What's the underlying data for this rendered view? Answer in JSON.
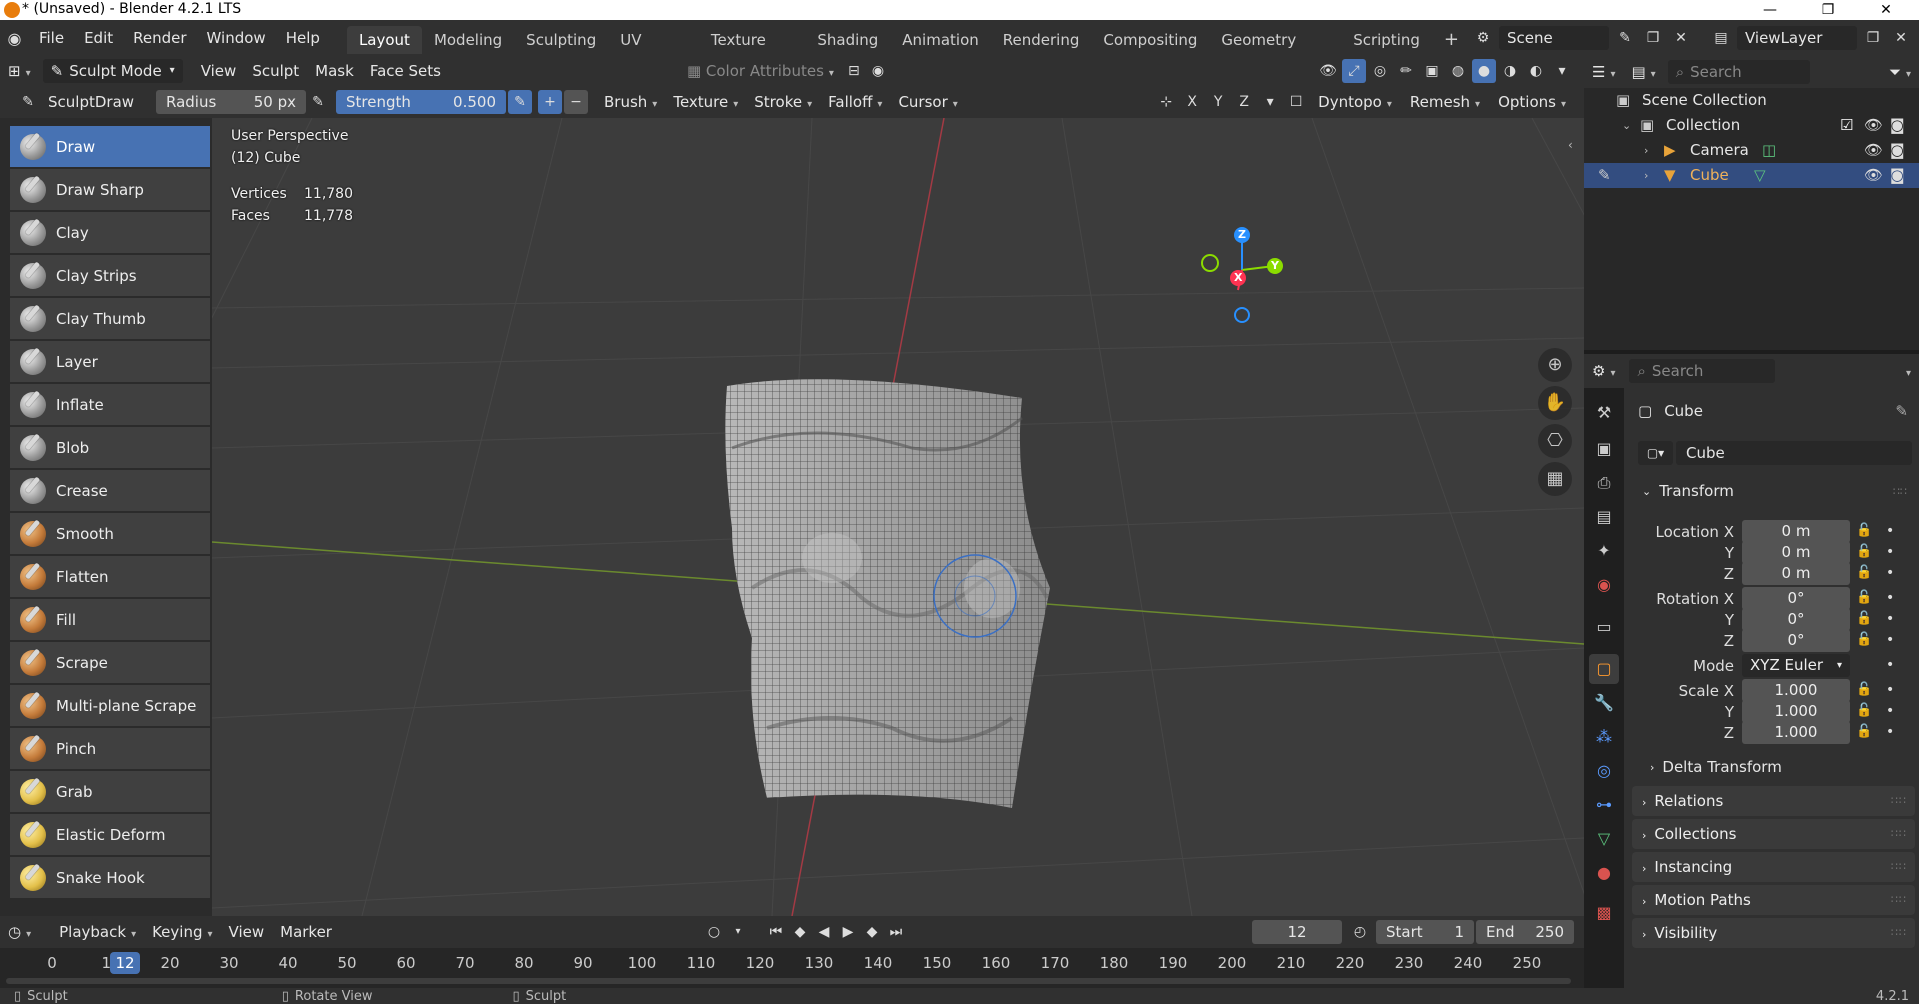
{
  "window": {
    "title": "* (Unsaved) - Blender 4.2.1 LTS",
    "minimize": "—",
    "maximize": "❐",
    "close": "✕"
  },
  "menu": [
    "File",
    "Edit",
    "Render",
    "Window",
    "Help"
  ],
  "workspaces": [
    "Layout",
    "Modeling",
    "Sculpting",
    "UV Editing",
    "Texture Paint",
    "Shading",
    "Animation",
    "Rendering",
    "Compositing",
    "Geometry Nodes",
    "Scripting"
  ],
  "active_workspace": "Layout",
  "scene": {
    "name": "Scene",
    "view_layer": "ViewLayer"
  },
  "header": {
    "mode": "Sculpt Mode",
    "menus": [
      "View",
      "Sculpt",
      "Mask",
      "Face Sets"
    ],
    "color_attributes": "Color Attributes"
  },
  "tool_settings": {
    "brush_name": "SculptDraw",
    "radius_label": "Radius",
    "radius_value": "50 px",
    "strength_label": "Strength",
    "strength_value": "0.500",
    "plus": "+",
    "minus": "−",
    "menus": [
      "Brush",
      "Texture",
      "Stroke",
      "Falloff",
      "Cursor"
    ],
    "axis": [
      "X",
      "Y",
      "Z"
    ],
    "dyntopo": "Dyntopo",
    "remesh": "Remesh",
    "options": "Options"
  },
  "tools": [
    "Draw",
    "Draw Sharp",
    "Clay",
    "Clay Strips",
    "Clay Thumb",
    "Layer",
    "Inflate",
    "Blob",
    "Crease",
    "Smooth",
    "Flatten",
    "Fill",
    "Scrape",
    "Multi-plane Scrape",
    "Pinch",
    "Grab",
    "Elastic Deform",
    "Snake Hook"
  ],
  "active_tool": "Draw",
  "viewport": {
    "perspective": "User Perspective",
    "object": "(12) Cube",
    "vertices_label": "Vertices",
    "vertices": "11,780",
    "faces_label": "Faces",
    "faces": "11,778",
    "gizmo": {
      "x": "X",
      "y": "Y",
      "z": "Z"
    }
  },
  "outliner": {
    "search_placeholder": "Search",
    "scene_collection": "Scene Collection",
    "collection": "Collection",
    "items": [
      "Camera",
      "Cube"
    ],
    "selected": "Cube"
  },
  "properties": {
    "search_placeholder": "Search",
    "object_name": "Cube",
    "data_name": "Cube",
    "transform_title": "Transform",
    "location_label": "Location X",
    "location": [
      "0 m",
      "0 m",
      "0 m"
    ],
    "rotation_label": "Rotation X",
    "rotation": [
      "0°",
      "0°",
      "0°"
    ],
    "mode_label": "Mode",
    "rotation_mode": "XYZ Euler",
    "scale_label": "Scale X",
    "scale": [
      "1.000",
      "1.000",
      "1.000"
    ],
    "axis_y": "Y",
    "axis_z": "Z",
    "delta_transform": "Delta Transform",
    "panels": [
      "Relations",
      "Collections",
      "Instancing",
      "Motion Paths",
      "Visibility"
    ]
  },
  "timeline": {
    "menus": [
      "Playback",
      "Keying",
      "View",
      "Marker"
    ],
    "current_frame": "12",
    "start_label": "Start",
    "start": "1",
    "end_label": "End",
    "end": "250",
    "ticks": [
      "0",
      "10",
      "20",
      "30",
      "40",
      "50",
      "60",
      "70",
      "80",
      "90",
      "100",
      "110",
      "120",
      "130",
      "140",
      "150",
      "160",
      "170",
      "180",
      "190",
      "200",
      "210",
      "220",
      "230",
      "240",
      "250"
    ],
    "playhead_label": "12"
  },
  "statusbar": {
    "left": "Sculpt",
    "middle": "Rotate View",
    "right_action": "Sculpt",
    "version": "4.2.1"
  },
  "colors": {
    "accent": "#4772b3",
    "selection": "#334d80",
    "x_axis": "#ff3352",
    "y_axis": "#8bdc00",
    "z_axis": "#2890ff",
    "object_orange": "#e87d0d"
  }
}
